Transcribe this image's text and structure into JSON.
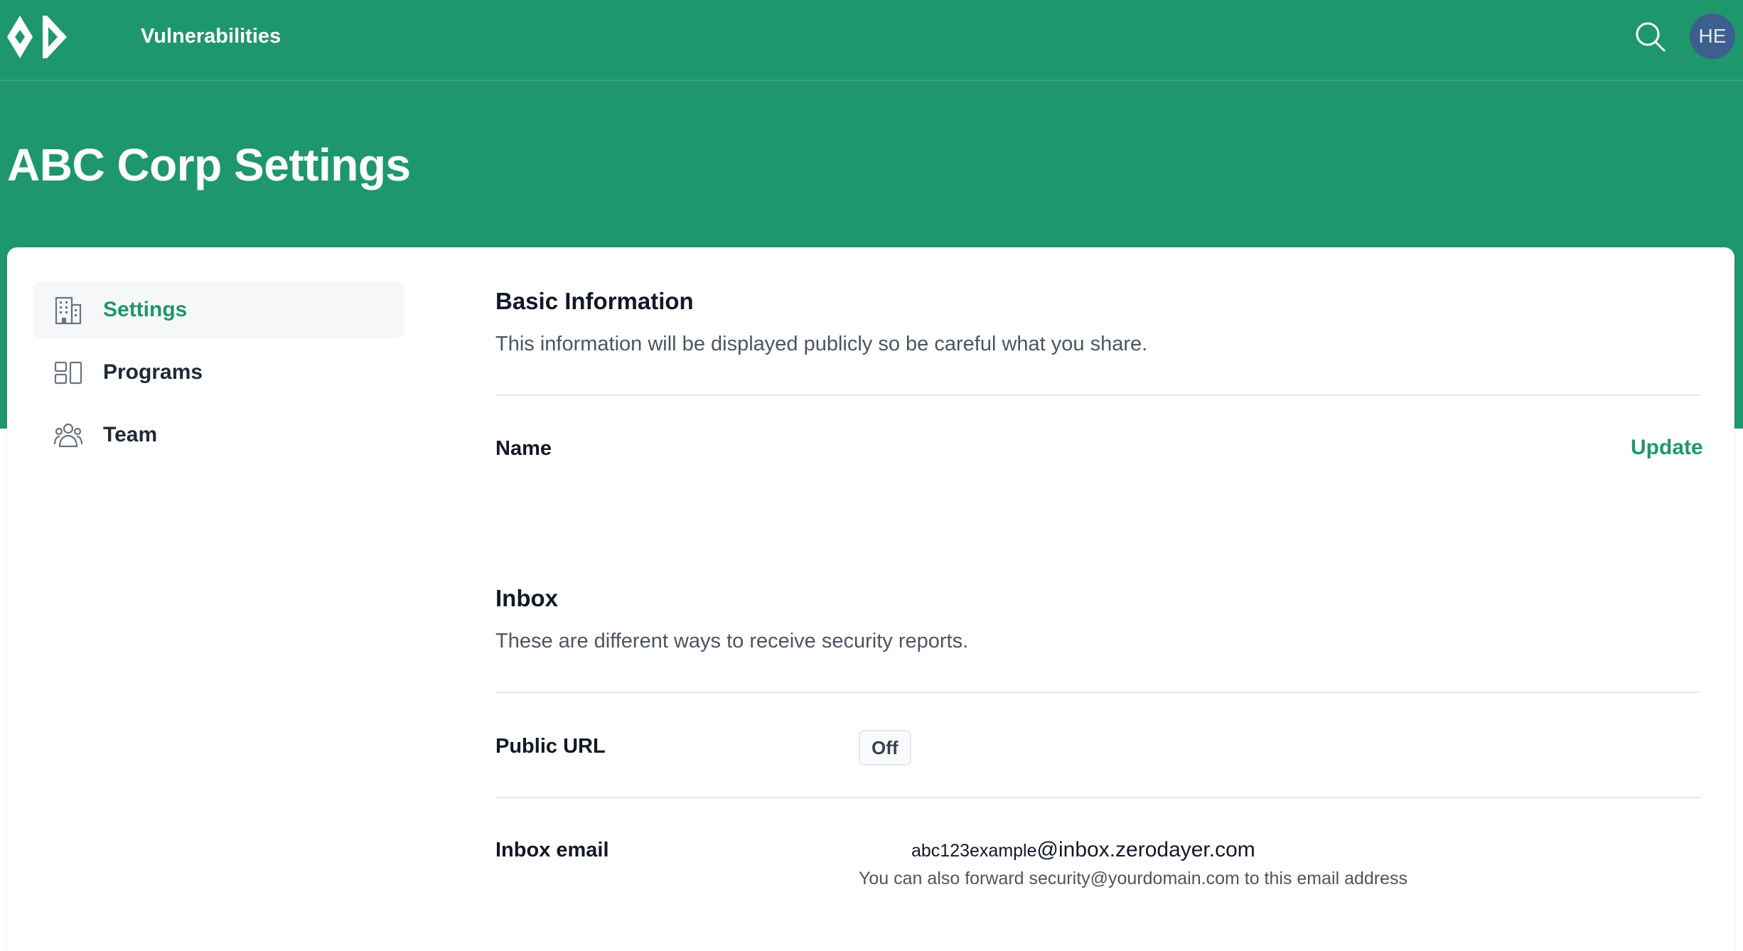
{
  "header": {
    "nav_link": "Vulnerabilities",
    "avatar_initials": "HE",
    "brand_color": "#1e976c",
    "avatar_color": "#3d5f8f"
  },
  "page": {
    "title": "ABC Corp Settings"
  },
  "sidebar": {
    "items": [
      {
        "label": "Settings",
        "icon": "building-icon",
        "active": true
      },
      {
        "label": "Programs",
        "icon": "layout-grid-icon",
        "active": false
      },
      {
        "label": "Team",
        "icon": "users-icon",
        "active": false
      }
    ]
  },
  "basic_info": {
    "title": "Basic Information",
    "description": "This information will be displayed publicly so be careful what you share.",
    "name_label": "Name",
    "name_value": "",
    "update_label": "Update"
  },
  "inbox": {
    "title": "Inbox",
    "description": "These are different ways to receive security reports.",
    "public_url_label": "Public URL",
    "public_url_status": "Off",
    "email_label": "Inbox email",
    "email_local": "abc123example",
    "email_domain": "@inbox.zerodayer.com",
    "email_hint": "You can also forward security@yourdomain.com to this email address"
  }
}
